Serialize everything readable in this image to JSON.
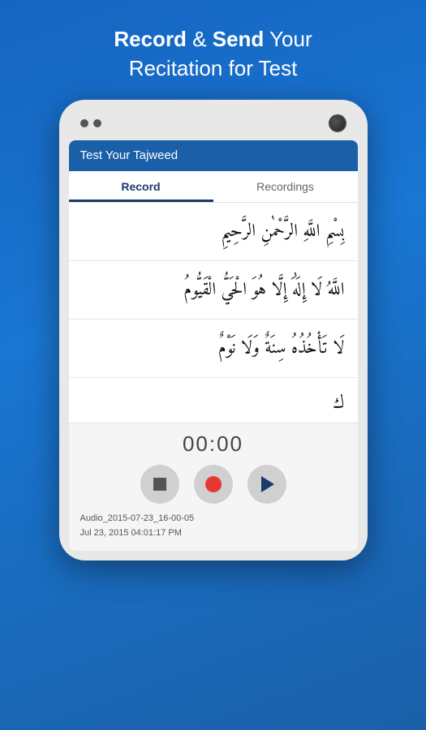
{
  "header": {
    "line1": "Record & Send Your",
    "line1_bold1": "Record",
    "line1_bold2": "Send",
    "line2": "Recitation for Test"
  },
  "app": {
    "title": "Test Your Tajweed"
  },
  "tabs": [
    {
      "id": "record",
      "label": "Record",
      "active": true
    },
    {
      "id": "recordings",
      "label": "Recordings",
      "active": false
    }
  ],
  "arabic_verses": [
    {
      "text": "بِسْمِ اللَّهِ الرَّحْمٰنِ الرَّحِيمِ"
    },
    {
      "text": "اللَّهُ لَا إِلَٰهَ إِلَّا هُوَ الْحَيُّ الْقَيُّومُ"
    },
    {
      "text": "لَا تَأْخُذُهُ سِنَةٌ وَلَا نَوْمٌ"
    }
  ],
  "timer": {
    "display": "00:00"
  },
  "controls": {
    "stop_label": "stop",
    "record_label": "record",
    "play_label": "play"
  },
  "audio_info": {
    "filename": "Audio_2015-07-23_16-00-05",
    "datetime": "Jul 23, 2015 04:01:17 PM"
  }
}
